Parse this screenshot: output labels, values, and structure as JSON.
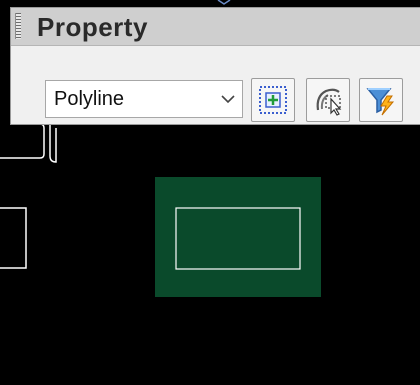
{
  "palette": {
    "title": "Property",
    "object_type_select": {
      "value": "Polyline",
      "options_visible": [
        "Polyline"
      ]
    },
    "tools": [
      {
        "name": "select-objects-icon"
      },
      {
        "name": "quick-select-icon"
      },
      {
        "name": "filter-lightning-icon"
      }
    ]
  },
  "drawing": {
    "background": "#000000",
    "highlight_fill": "#0a4a2b",
    "stroke": "#ffffff"
  }
}
